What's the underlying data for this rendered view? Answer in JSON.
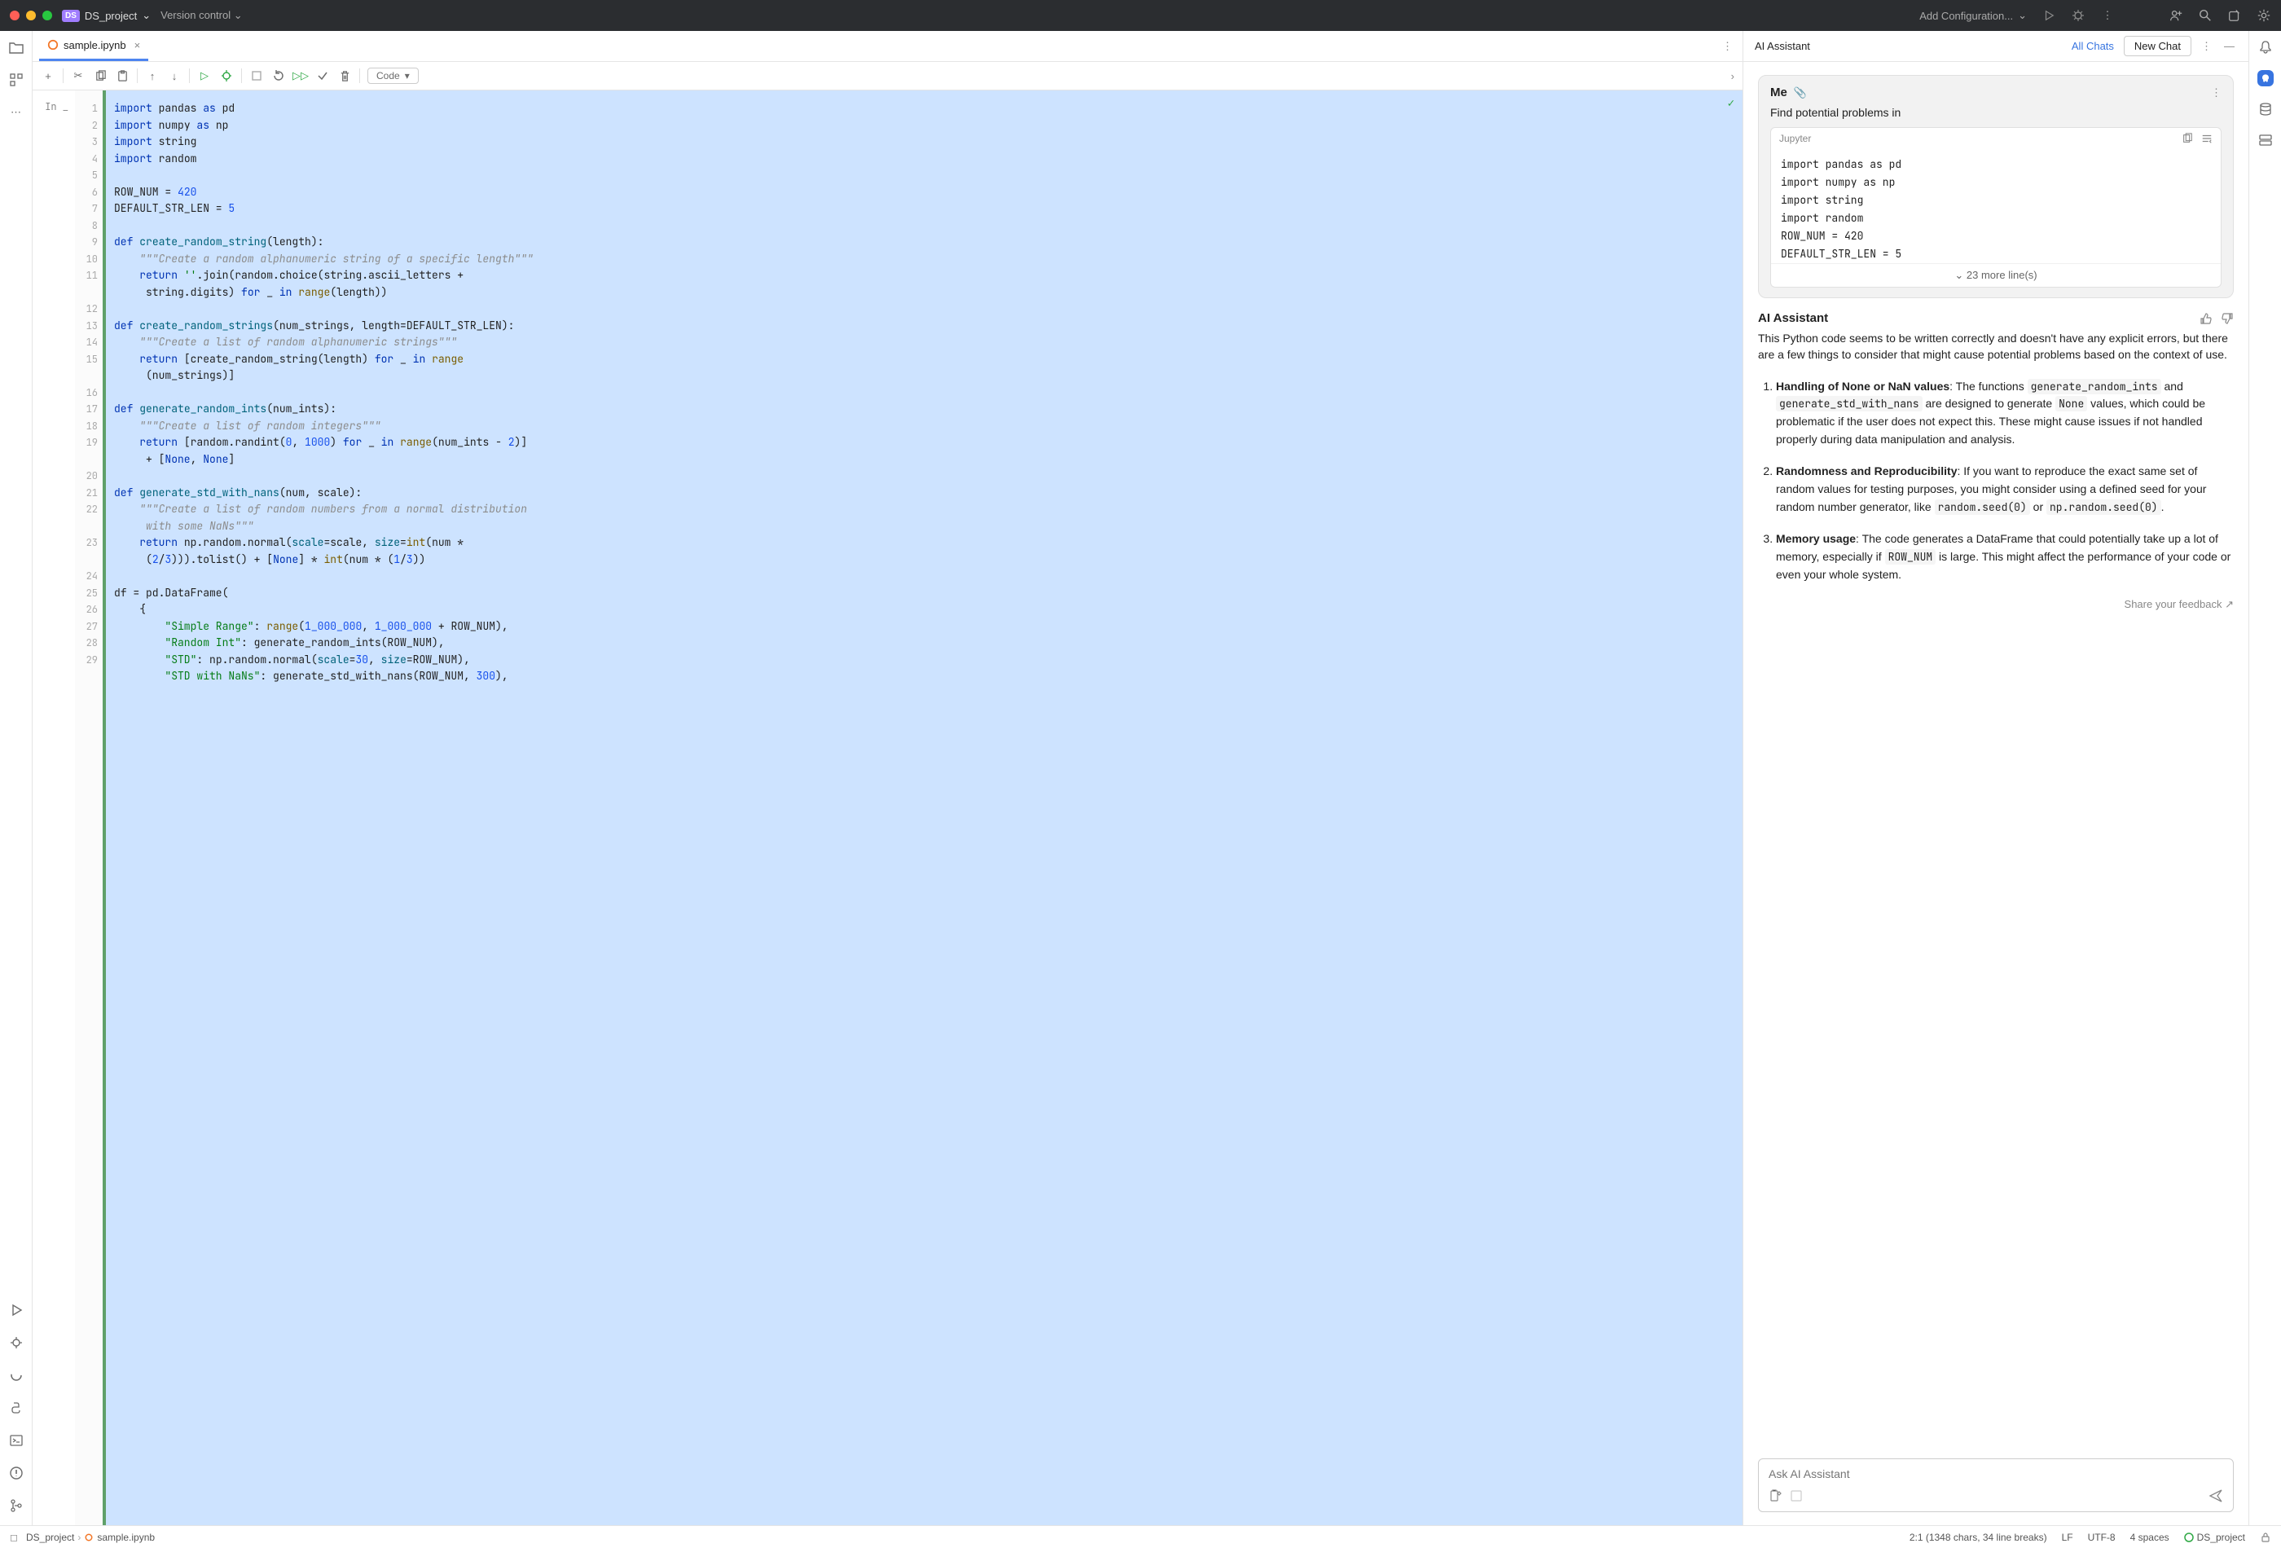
{
  "title": {
    "project_badge": "DS",
    "project": "DS_project",
    "vcs": "Version control",
    "run_config": "Add Configuration..."
  },
  "tab": {
    "name": "sample.ipynb"
  },
  "cell_toolbar": {
    "type": "Code"
  },
  "gutter": {
    "prompt": "In _"
  },
  "lines": [
    "1",
    "2",
    "3",
    "4",
    "5",
    "6",
    "7",
    "8",
    "9",
    "10",
    "11",
    "",
    "12",
    "13",
    "14",
    "15",
    "",
    "16",
    "17",
    "18",
    "19",
    "",
    "20",
    "21",
    "22",
    "",
    "23",
    "",
    "24",
    "25",
    "26",
    "27",
    "28",
    "29",
    ""
  ],
  "assistant": {
    "title": "AI Assistant",
    "all_chats": "All Chats",
    "new_chat": "New Chat",
    "me_label": "Me",
    "me_text": "Find potential problems in",
    "snippet_lang": "Jupyter",
    "snippet_lines": [
      "import pandas as pd",
      "import numpy as np",
      "import string",
      "import random",
      "ROW_NUM = 420",
      "DEFAULT_STR_LEN = 5"
    ],
    "snippet_more": "23 more line(s)",
    "resp_title": "AI Assistant",
    "resp_intro": "This Python code seems to be written correctly and doesn't have any explicit errors, but there are a few things to consider that might cause potential problems based on the context of use.",
    "item1_title": "Handling of None or NaN values",
    "item1_a": ": The functions ",
    "item1_code1": "generate_random_ints",
    "item1_b": " and ",
    "item1_code2": "generate_std_with_nans",
    "item1_c": " are designed to generate ",
    "item1_code3": "None",
    "item1_d": " values, which could be problematic if the user does not expect this. These might cause issues if not handled properly during data manipulation and analysis.",
    "item2_title": "Randomness and Reproducibility",
    "item2_a": ": If you want to reproduce the exact same set of random values for testing purposes, you might consider using a defined seed for your random number generator, like ",
    "item2_code1": "random.seed(0)",
    "item2_b": " or ",
    "item2_code2": "np.random.seed(0)",
    "item2_c": ".",
    "item3_title": "Memory usage",
    "item3_a": ": The code generates a DataFrame that could potentially take up a lot of memory, especially if ",
    "item3_code1": "ROW_NUM",
    "item3_b": " is large. This might affect the performance of your code or even your whole system.",
    "feedback": "Share your feedback ↗",
    "input_placeholder": "Ask AI Assistant"
  },
  "status": {
    "crumb1": "DS_project",
    "crumb2": "sample.ipynb",
    "pos": "2:1 (1348 chars, 34 line breaks)",
    "eol": "LF",
    "enc": "UTF-8",
    "indent": "4 spaces",
    "interpreter": "DS_project"
  }
}
